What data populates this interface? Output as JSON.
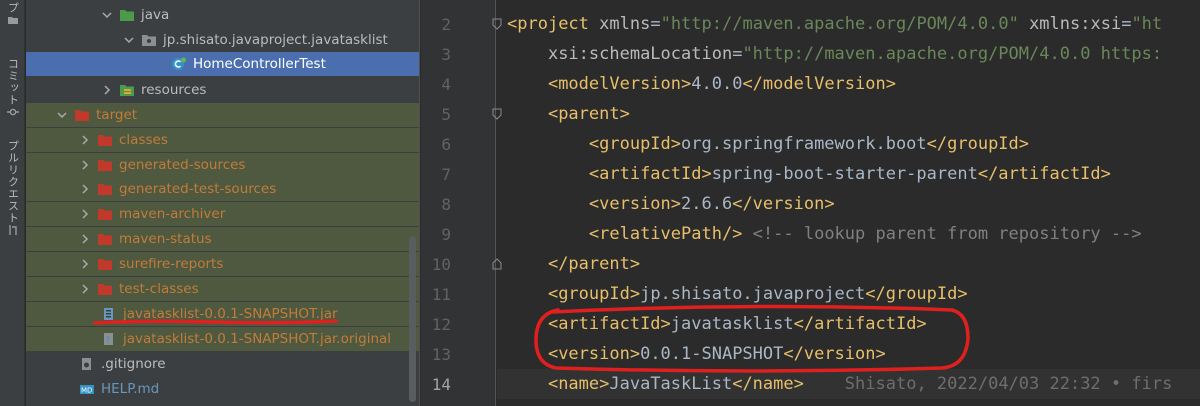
{
  "toolstrip": {
    "tabs": [
      {
        "label": "プ",
        "icon": "folder-icon"
      },
      {
        "label": "コミット",
        "icon": "commit-icon"
      },
      {
        "label": "プルリクエスト",
        "icon": "pull-request-icon"
      }
    ]
  },
  "tree": {
    "rows": [
      {
        "label": "java",
        "icon": "source-folder-icon",
        "expanded": true
      },
      {
        "label": "jp.shisato.javaproject.javatasklist",
        "icon": "package-icon",
        "expanded": true
      },
      {
        "label": "HomeControllerTest",
        "icon": "java-class-icon"
      },
      {
        "label": "resources",
        "icon": "resources-folder-icon",
        "expanded": false
      },
      {
        "label": "target",
        "icon": "excluded-folder-icon",
        "expanded": true
      },
      {
        "label": "classes",
        "icon": "excluded-folder-icon",
        "expanded": false
      },
      {
        "label": "generated-sources",
        "icon": "excluded-folder-icon",
        "expanded": false
      },
      {
        "label": "generated-test-sources",
        "icon": "excluded-folder-icon",
        "expanded": false
      },
      {
        "label": "maven-archiver",
        "icon": "excluded-folder-icon",
        "expanded": false
      },
      {
        "label": "maven-status",
        "icon": "excluded-folder-icon",
        "expanded": false
      },
      {
        "label": "surefire-reports",
        "icon": "excluded-folder-icon",
        "expanded": false
      },
      {
        "label": "test-classes",
        "icon": "excluded-folder-icon",
        "expanded": false
      },
      {
        "label": "javatasklist-0.0.1-SNAPSHOT.jar",
        "icon": "jar-file-icon"
      },
      {
        "label": "javatasklist-0.0.1-SNAPSHOT.jar.original",
        "icon": "unknown-file-icon"
      },
      {
        "label": ".gitignore",
        "icon": "gitignore-file-icon"
      },
      {
        "label": "HELP.md",
        "icon": "markdown-file-icon"
      }
    ]
  },
  "editor": {
    "current_line": "14",
    "lines": [
      {
        "n": "2",
        "tokens": [
          {
            "t": "<",
            "c": "tag"
          },
          {
            "t": "project ",
            "c": "tag"
          },
          {
            "t": "xmlns",
            "c": "attr"
          },
          {
            "t": "=",
            "c": "txt"
          },
          {
            "t": "\"http://maven.apache.org/POM/4.0.0\"",
            "c": "val"
          },
          {
            "t": " ",
            "c": "txt"
          },
          {
            "t": "xmlns:xsi",
            "c": "attr"
          },
          {
            "t": "=",
            "c": "txt"
          },
          {
            "t": "\"ht",
            "c": "val"
          }
        ]
      },
      {
        "n": "3",
        "tokens": [
          {
            "t": "    ",
            "c": "txt"
          },
          {
            "t": "xsi:schemaLocation",
            "c": "attr"
          },
          {
            "t": "=",
            "c": "txt"
          },
          {
            "t": "\"http://maven.apache.org/POM/4.0.0 https:",
            "c": "val"
          }
        ]
      },
      {
        "n": "4",
        "tokens": [
          {
            "t": "    ",
            "c": "txt"
          },
          {
            "t": "<modelVersion>",
            "c": "tag"
          },
          {
            "t": "4.0.0",
            "c": "txt"
          },
          {
            "t": "</modelVersion>",
            "c": "tag"
          }
        ]
      },
      {
        "n": "5",
        "tokens": [
          {
            "t": "    ",
            "c": "txt"
          },
          {
            "t": "<parent>",
            "c": "tag"
          }
        ]
      },
      {
        "n": "6",
        "tokens": [
          {
            "t": "        ",
            "c": "txt"
          },
          {
            "t": "<groupId>",
            "c": "tag"
          },
          {
            "t": "org.springframework.boot",
            "c": "txt"
          },
          {
            "t": "</groupId>",
            "c": "tag"
          }
        ]
      },
      {
        "n": "7",
        "tokens": [
          {
            "t": "        ",
            "c": "txt"
          },
          {
            "t": "<artifactId>",
            "c": "tag"
          },
          {
            "t": "spring-boot-starter-parent",
            "c": "txt"
          },
          {
            "t": "</artifactId>",
            "c": "tag"
          }
        ]
      },
      {
        "n": "8",
        "tokens": [
          {
            "t": "        ",
            "c": "txt"
          },
          {
            "t": "<version>",
            "c": "tag"
          },
          {
            "t": "2.6.6",
            "c": "txt"
          },
          {
            "t": "</version>",
            "c": "tag"
          }
        ]
      },
      {
        "n": "9",
        "tokens": [
          {
            "t": "        ",
            "c": "txt"
          },
          {
            "t": "<relativePath/>",
            "c": "tag"
          },
          {
            "t": " ",
            "c": "txt"
          },
          {
            "t": "<!-- lookup parent from repository -->",
            "c": "comment"
          }
        ]
      },
      {
        "n": "10",
        "tokens": [
          {
            "t": "    ",
            "c": "txt"
          },
          {
            "t": "</parent>",
            "c": "tag"
          }
        ]
      },
      {
        "n": "11",
        "tokens": [
          {
            "t": "    ",
            "c": "txt"
          },
          {
            "t": "<groupId>",
            "c": "tag"
          },
          {
            "t": "jp.shisato.javaproject",
            "c": "txt"
          },
          {
            "t": "</groupId>",
            "c": "tag"
          }
        ]
      },
      {
        "n": "12",
        "tokens": [
          {
            "t": "    ",
            "c": "txt"
          },
          {
            "t": "<artifactId>",
            "c": "tag"
          },
          {
            "t": "javatasklist",
            "c": "txt"
          },
          {
            "t": "</artifactId>",
            "c": "tag"
          }
        ]
      },
      {
        "n": "13",
        "tokens": [
          {
            "t": "    ",
            "c": "txt"
          },
          {
            "t": "<version>",
            "c": "tag"
          },
          {
            "t": "0.0.1-SNAPSHOT",
            "c": "txt"
          },
          {
            "t": "</version>",
            "c": "tag"
          }
        ]
      },
      {
        "n": "14",
        "tokens": [
          {
            "t": "    ",
            "c": "txt"
          },
          {
            "t": "<name>",
            "c": "tag"
          },
          {
            "t": "JavaTaskList",
            "c": "txt"
          },
          {
            "t": "</name>",
            "c": "tag"
          },
          {
            "t": "    Shisato, 2022/04/03 22:32 • firs",
            "c": "blame"
          }
        ]
      }
    ]
  },
  "colors": {
    "annotation": "#e0201e",
    "tree_selection": "#4b6eaf",
    "excluded_folder": "#c27c3a",
    "xml_tag": "#e8bf6a",
    "xml_value": "#6a8759"
  }
}
